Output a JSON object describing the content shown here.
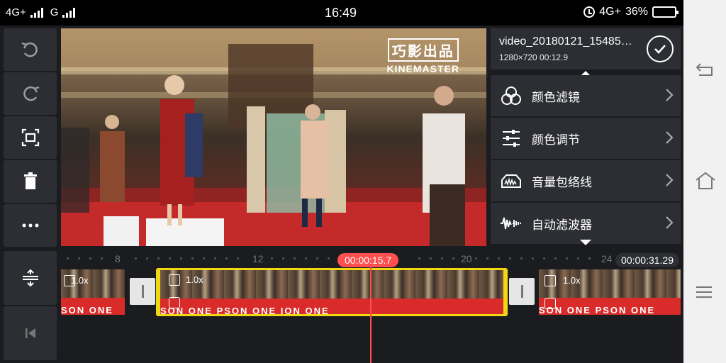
{
  "status_bar": {
    "left_network_1": "4G+",
    "left_network_2": "G",
    "time": "16:49",
    "right_network": "4G+",
    "battery": "36%",
    "battery_level": 0.36
  },
  "left_toolbar": {
    "undo_icon": "undo-icon",
    "redo_icon": "redo-icon",
    "crop_icon": "crop-icon",
    "delete_icon": "trash-icon",
    "more_icon": "more-icon",
    "expand_icon": "expand-vertical-icon",
    "jump_start_icon": "jump-to-start-icon"
  },
  "preview": {
    "watermark_cn": "巧影出品",
    "watermark_en": "KINEMASTER"
  },
  "panel": {
    "title": "video_20180121_15485…",
    "subtitle": "1280×720  00:12.9",
    "items": [
      {
        "label": "颜色滤镜",
        "icon": "color-filter-icon"
      },
      {
        "label": "颜色调节",
        "icon": "color-adjust-icon"
      },
      {
        "label": "音量包络线",
        "icon": "volume-envelope-icon"
      },
      {
        "label": "自动滤波器",
        "icon": "auto-filter-icon"
      }
    ]
  },
  "timeline": {
    "ticks": [
      "8",
      "12",
      "20",
      "24"
    ],
    "current_time": "00:00:15.7",
    "total_time": "00:00:31.29",
    "clips": [
      {
        "speed": "1.0x",
        "sign": "SON ONE"
      },
      {
        "speed": "1.0x",
        "sign": "SON ONE PSON ONE ION ONE"
      },
      {
        "speed": "1.0x",
        "sign": "SON ONE PSON ONE"
      }
    ]
  }
}
